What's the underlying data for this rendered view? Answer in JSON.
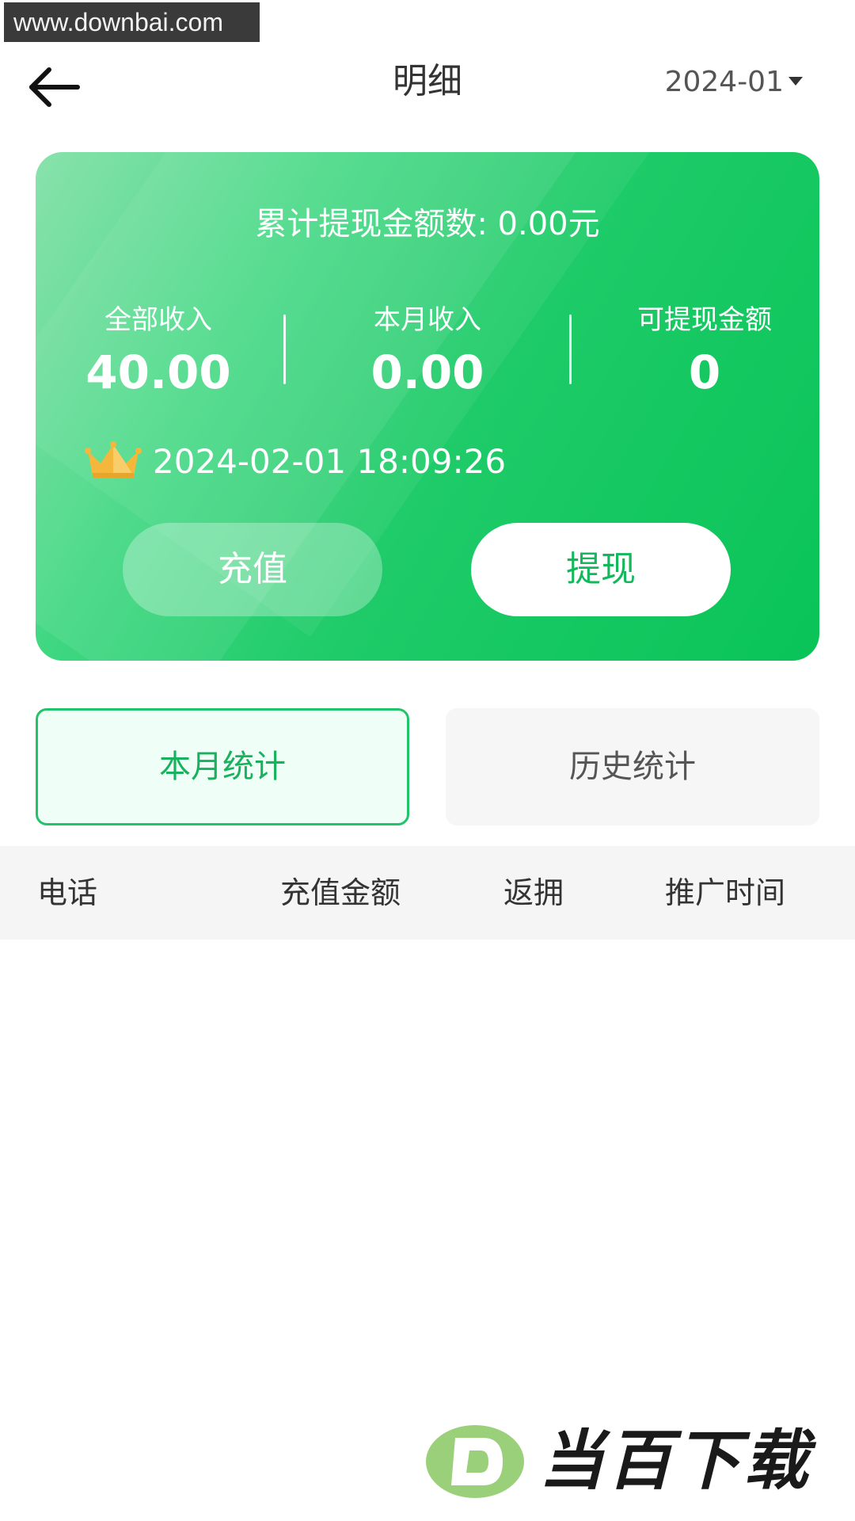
{
  "watermark": {
    "site": "www.downbai.com",
    "brand": "当百下载"
  },
  "header": {
    "title": "明细",
    "month": "2024-01"
  },
  "card": {
    "withdraw_total": "累计提现金额数: 0.00元",
    "stats": [
      {
        "label": "全部收入",
        "value": "40.00"
      },
      {
        "label": "本月收入",
        "value": "0.00"
      },
      {
        "label": "可提现金额",
        "value": "0"
      }
    ],
    "time": "2024-02-01 18:09:26",
    "recharge_label": "充值",
    "withdraw_label": "提现"
  },
  "tabs": [
    {
      "label": "本月统计",
      "active": true
    },
    {
      "label": "历史统计",
      "active": false
    }
  ],
  "table": {
    "columns": [
      "电话",
      "充值金额",
      "返拥",
      "推广时间"
    ],
    "rows": []
  },
  "colors": {
    "accent": "#18b25e",
    "card_start": "#7fe0a5",
    "card_end": "#09c458",
    "crown": "#f4b73c"
  }
}
